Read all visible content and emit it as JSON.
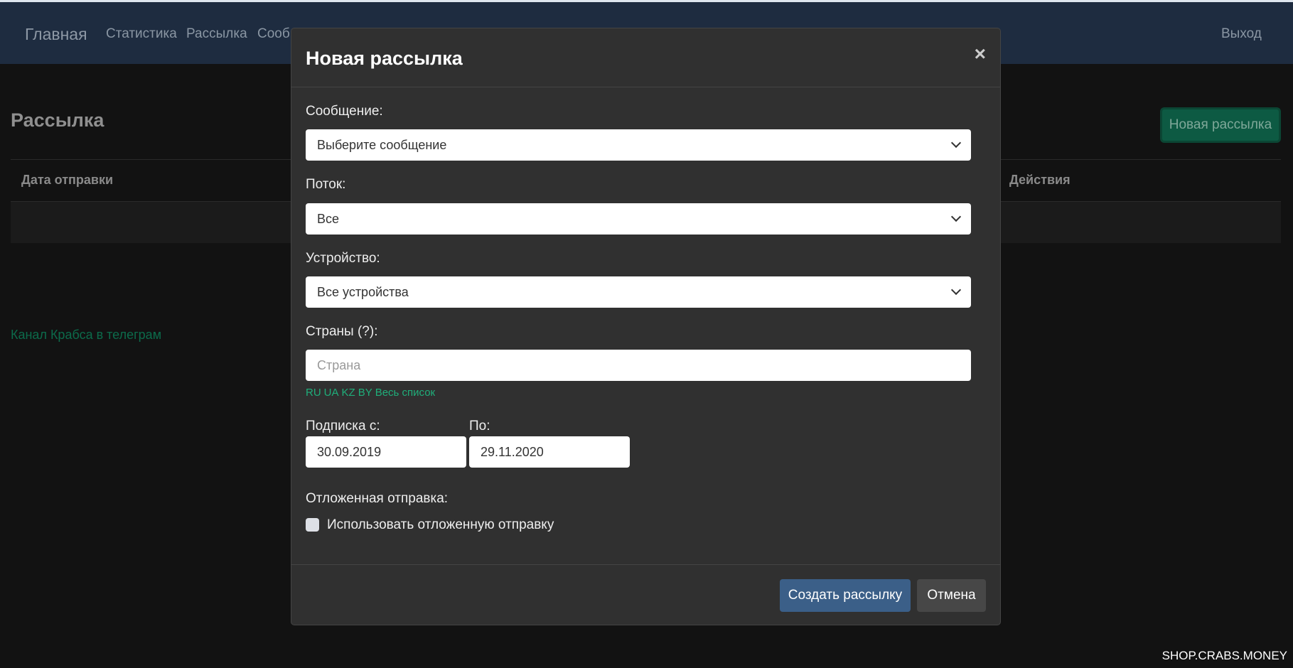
{
  "nav": {
    "brand": "Главная",
    "items": [
      "Статистика",
      "Рассылка",
      "Сооб"
    ],
    "logout": "Выход"
  },
  "page": {
    "title": "Рассылка",
    "new_button": "Новая рассылка",
    "columns": {
      "date": "Дата отправки",
      "actions": "Действия"
    },
    "telegram_link": "Канал Крабса в телеграм"
  },
  "modal": {
    "title": "Новая рассылка",
    "close": "×",
    "message_label": "Сообщение:",
    "message_value": "Выберите сообщение",
    "stream_label": "Поток:",
    "stream_value": "Все",
    "device_label": "Устройство:",
    "device_value": "Все устройства",
    "countries_label": "Страны (?):",
    "countries_placeholder": "Страна",
    "country_links": [
      "RU",
      "UA",
      "KZ",
      "BY",
      "Весь список"
    ],
    "sub_from_label": "Подписка с:",
    "sub_from": "30.09.2019",
    "sub_to_label": "По:",
    "sub_to": "29.11.2020",
    "delayed_label": "Отложенная отправка:",
    "delayed_checkbox": "Использовать отложенную отправку",
    "delayed_checked": false,
    "create_button": "Создать рассылку",
    "cancel_button": "Отмена"
  },
  "watermark": "SHOP.CRABS.MONEY"
}
